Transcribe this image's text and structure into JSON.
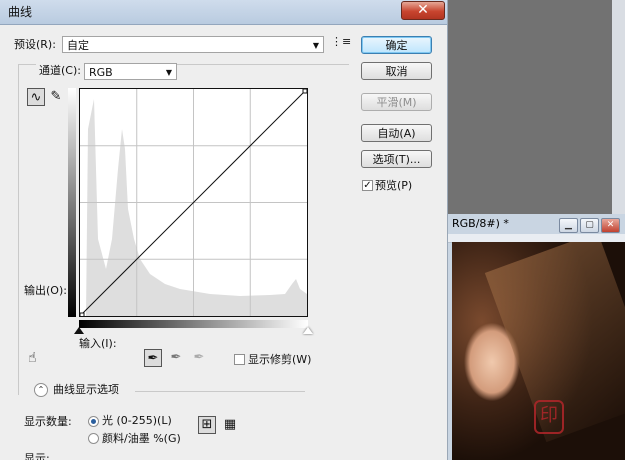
{
  "dialog": {
    "title": "曲线",
    "close_glyph": "✕",
    "preset_label": "预设(R):",
    "preset_value": "自定",
    "channel_label": "通道(C):",
    "channel_value": "RGB",
    "output_label": "输出(O):",
    "input_label": "输入(I):",
    "buttons": {
      "ok": "确定",
      "cancel": "取消",
      "smooth": "平滑(M)",
      "auto": "自动(A)",
      "options": "选项(T)..."
    },
    "preview_label": "预览(P)",
    "preview_checked": true,
    "show_clipping_label": "显示修剪(W)",
    "show_clipping_checked": false,
    "curve_display_options_label": "曲线显示选项",
    "show_amount_label": "显示数量:",
    "light_option": "光 (0-255)(L)",
    "pigment_option": "颜料/油墨 %(G)",
    "light_selected": true,
    "bottom_partial": "显示:"
  },
  "background_window": {
    "title": "RGB/8#) *"
  },
  "colors": {
    "dialog_bg": "#eeeeee",
    "histogram": "#dedede",
    "titlebar": "#c3d3e6",
    "close": "#c8452f"
  }
}
